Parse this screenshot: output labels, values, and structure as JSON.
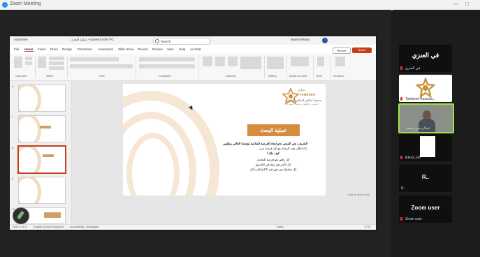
{
  "zoom": {
    "title": "Zoom Meeting",
    "win_min": "—",
    "win_close": "□"
  },
  "ppt": {
    "autosave": "AutoSave",
    "doc_title": "عملية البحث • Saved to this PC",
    "search_placeholder": "Search",
    "user_name": "Naomi Misato",
    "tabs": [
      "File",
      "Home",
      "Insert",
      "Draw",
      "Design",
      "Transitions",
      "Animations",
      "Slide Show",
      "Record",
      "Review",
      "View",
      "Help",
      "Acrobat"
    ],
    "record_label": "Record",
    "share_label": "Share",
    "ribbon_groups": [
      "Clipboard",
      "Slides",
      "Font",
      "Paragraph",
      "Drawing",
      "Editing",
      "Adobe Acrobat",
      "Voice",
      "Designer"
    ],
    "slide_numbers": [
      "6",
      "7",
      "8",
      "9",
      "10"
    ],
    "notes_hint": "Click to add notes",
    "status_slide": "Slide 8 of 11",
    "status_lang": "English (United Kingdom)",
    "status_access": "Accessibility: Investigate",
    "status_notes": "Notes",
    "status_zoom": "67%"
  },
  "slide": {
    "logo_ar": "تمكين",
    "logo_en": "TAMKEEN",
    "logo_ar2": "جمعية تمكين لتمكين الفتيات",
    "logo_ar3": "التمكين والتطوير وصقل المهارات",
    "heading": "عملية البحث",
    "lines": [
      "التعريف: هي السعي نحو ايجاد الفرصة الملائمة لوضعنا الحالي وتطوير",
      "ذاتنا خلال هذه الرحلة مع كل فرصة تبرز",
      "كيف ذلك؟",
      "كل رفض هو فرصة للتعديل",
      "كل تأخير هو رزق في الطريق",
      "كل محاولة هي فوز في الاكتشاف ذاتك"
    ]
  },
  "participants": [
    {
      "name_big": "في العنزي",
      "label": "في العنزي",
      "muted": true
    },
    {
      "label": "Tamkeen Associa...",
      "muted": true
    },
    {
      "label": "عبدالرحمن محمد",
      "muted": true
    },
    {
      "label": "ikkool_Gh",
      "muted": true
    },
    {
      "name_big": "R..",
      "label": "R..",
      "muted": false
    },
    {
      "name_big": "Zoom user",
      "label": "Zoom user",
      "muted": true
    }
  ],
  "colors": {
    "accent_ppt": "#c43e1c",
    "slide_heading_bg": "#d58c3f",
    "active_speaker": "#9ee04a",
    "muted_mic": "#e03131"
  },
  "icons": [
    "zoom-logo-icon",
    "search-icon",
    "mic-muted-icon",
    "cursor-icon",
    "camera-icon"
  ]
}
